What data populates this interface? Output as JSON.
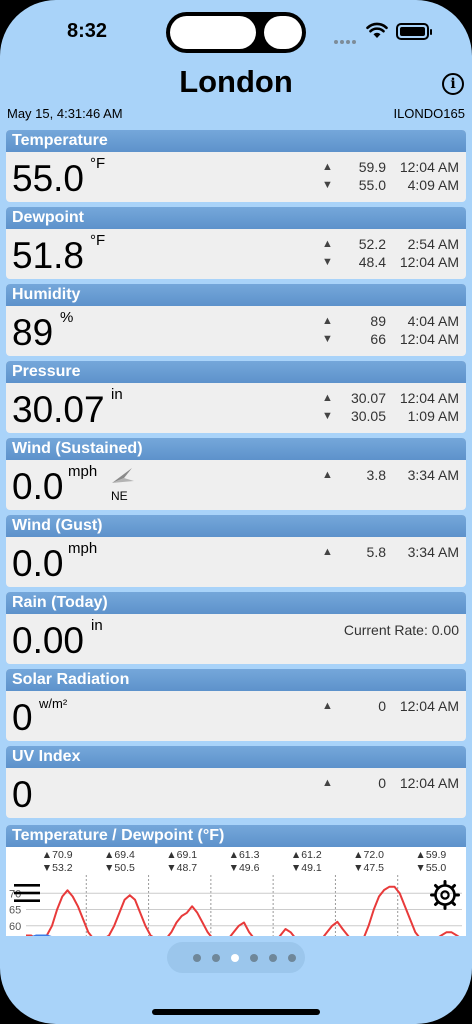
{
  "status": {
    "time": "8:32"
  },
  "header": {
    "title": "London",
    "datetime": "May 15, 4:31:46 AM",
    "station_id": "ILONDO165"
  },
  "cards": {
    "temperature": {
      "title": "Temperature",
      "value": "55.0",
      "unit": "°F",
      "hi_value": "59.9",
      "hi_time": "12:04 AM",
      "lo_value": "55.0",
      "lo_time": "4:09 AM"
    },
    "dewpoint": {
      "title": "Dewpoint",
      "value": "51.8",
      "unit": "°F",
      "hi_value": "52.2",
      "hi_time": "2:54 AM",
      "lo_value": "48.4",
      "lo_time": "12:04 AM"
    },
    "humidity": {
      "title": "Humidity",
      "value": "89",
      "unit": "%",
      "hi_value": "89",
      "hi_time": "4:04 AM",
      "lo_value": "66",
      "lo_time": "12:04 AM"
    },
    "pressure": {
      "title": "Pressure",
      "value": "30.07",
      "unit": "in",
      "hi_value": "30.07",
      "hi_time": "12:04 AM",
      "lo_value": "30.05",
      "lo_time": "1:09 AM"
    },
    "wind_sustained": {
      "title": "Wind (Sustained)",
      "value": "0.0",
      "unit": "mph",
      "direction": "NE",
      "hi_value": "3.8",
      "hi_time": "3:34 AM"
    },
    "wind_gust": {
      "title": "Wind (Gust)",
      "value": "0.0",
      "unit": "mph",
      "hi_value": "5.8",
      "hi_time": "3:34 AM"
    },
    "rain": {
      "title": "Rain (Today)",
      "value": "0.00",
      "unit": "in",
      "current_rate": "Current Rate: 0.00"
    },
    "solar": {
      "title": "Solar Radiation",
      "value": "0",
      "unit": "w/m²",
      "hi_value": "0",
      "hi_time": "12:04 AM"
    },
    "uv": {
      "title": "UV Index",
      "value": "0",
      "hi_value": "0",
      "hi_time": "12:04 AM"
    }
  },
  "chart_card": {
    "title": "Temperature / Dewpoint (°F)"
  },
  "chart_data": {
    "type": "line",
    "title": "Temperature / Dewpoint (°F)",
    "day_highs": [
      "70.9",
      "69.4",
      "69.1",
      "61.3",
      "61.2",
      "72.0",
      "59.9"
    ],
    "day_lows": [
      "53.2",
      "50.5",
      "48.7",
      "49.6",
      "49.1",
      "47.5",
      "55.0"
    ],
    "y_tick_labels": [
      "70",
      "65",
      "60"
    ],
    "series": [
      {
        "color": "#e83a3a",
        "x": [
          0,
          2,
          4,
          6,
          8,
          10,
          12,
          14,
          16,
          18,
          20,
          22,
          24,
          26,
          28,
          30,
          32,
          34,
          36,
          38,
          40,
          42,
          44,
          46,
          48,
          50,
          52,
          54,
          56,
          58,
          60,
          62,
          64,
          66,
          68,
          70,
          72,
          74,
          76,
          78,
          80,
          82,
          84,
          86,
          88,
          90,
          92,
          94,
          96,
          98,
          100,
          102,
          104,
          106,
          108,
          110,
          112,
          114,
          116,
          118,
          120,
          122,
          124,
          126,
          128,
          130,
          132,
          134,
          136,
          138,
          140,
          142,
          144,
          146,
          148,
          150,
          152,
          154,
          156,
          158,
          160,
          162,
          164,
          166,
          168
        ],
        "y": [
          57,
          57,
          56,
          56,
          57,
          60,
          65,
          69,
          70.9,
          69,
          66,
          62,
          58,
          56,
          56,
          56,
          57,
          60,
          64,
          68,
          69.4,
          68,
          64,
          60,
          57,
          56,
          55,
          56,
          58,
          61,
          63,
          64,
          66,
          64,
          61,
          58,
          56,
          55,
          55,
          56,
          58,
          60,
          61,
          58,
          56,
          55,
          55,
          54,
          55,
          57,
          59,
          58,
          56,
          55,
          54,
          54,
          55,
          56,
          58,
          60,
          61.2,
          59,
          57,
          55,
          55,
          56,
          60,
          65,
          69,
          71,
          72,
          72,
          70,
          66,
          62,
          58,
          56,
          55,
          55,
          56,
          57,
          58,
          58,
          57,
          56
        ]
      },
      {
        "color": "#3a7be8",
        "x": [
          0,
          4,
          8,
          12,
          16,
          20
        ],
        "y": [
          56,
          57,
          57,
          56,
          56,
          56
        ]
      }
    ],
    "ylim": [
      55,
      75
    ]
  },
  "pager": {
    "pages": 6,
    "active_index": 2
  },
  "icons": [
    "info-icon",
    "hamburger-menu-icon",
    "settings-gear-icon",
    "wind-direction-arrow-icon",
    "wifi-icon",
    "battery-icon"
  ]
}
